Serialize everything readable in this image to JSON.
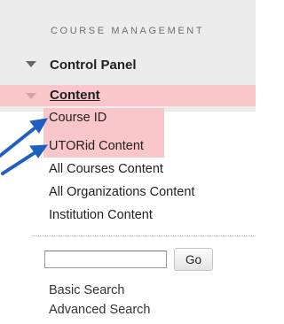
{
  "section": {
    "title": "COURSE MANAGEMENT"
  },
  "menu": {
    "control_panel_label": "Control Panel",
    "content_label": "Content",
    "content_items": [
      {
        "label": "Course ID",
        "highlighted": true
      },
      {
        "label": "UTORid Content",
        "highlighted": true
      },
      {
        "label": "All Courses Content",
        "highlighted": false
      },
      {
        "label": "All Organizations Content",
        "highlighted": false
      },
      {
        "label": "Institution Content",
        "highlighted": false
      }
    ]
  },
  "search": {
    "input_value": "",
    "go_label": "Go",
    "basic_label": "Basic Search",
    "advanced_label": "Advanced Search"
  },
  "colors": {
    "highlight": "#f9c7c9",
    "annotation_arrow": "#1f5fbf",
    "panel_background": "#ececec"
  },
  "annotations": {
    "arrow_icon": "annotation-arrow-icon"
  }
}
